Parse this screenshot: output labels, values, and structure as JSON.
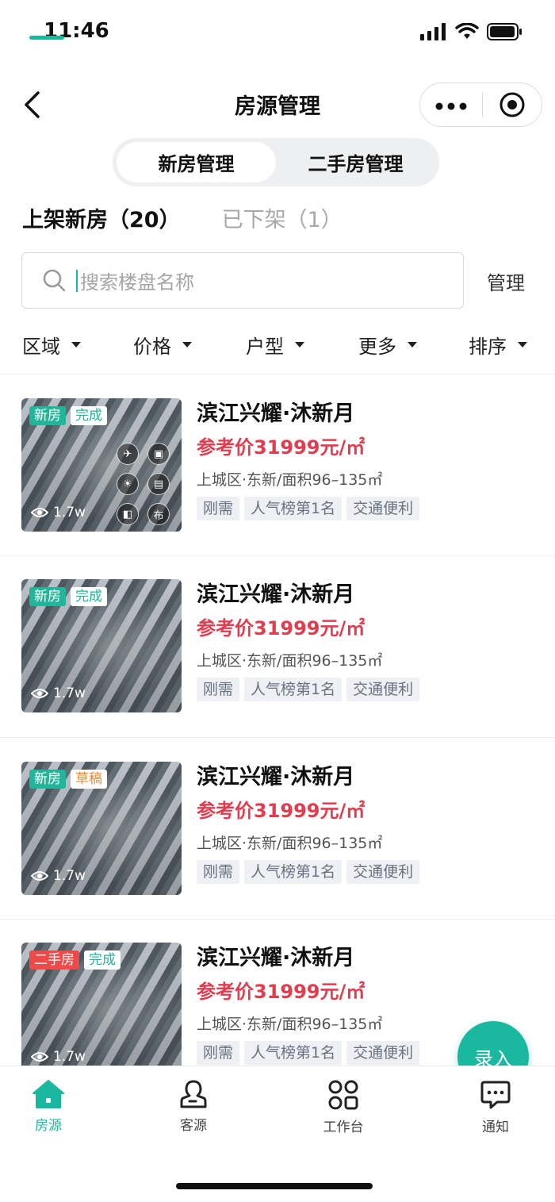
{
  "status_bar": {
    "time": "11:46"
  },
  "nav": {
    "title": "房源管理",
    "icons": [
      "back-arrow-icon",
      "more-dots-icon",
      "target-icon"
    ]
  },
  "segment": {
    "items": [
      "新房管理",
      "二手房管理"
    ],
    "active": 0
  },
  "tabs": [
    {
      "label": "上架新房（20）",
      "active": true
    },
    {
      "label": "已下架（1）",
      "active": false
    }
  ],
  "search": {
    "placeholder": "搜索楼盘名称",
    "manage_label": "管理"
  },
  "filters": [
    "区域",
    "价格",
    "户型",
    "更多",
    "排序"
  ],
  "listings": [
    {
      "type_tag": "新房",
      "status_tag": "完成",
      "views": "1.7w",
      "name": "滨江兴耀·沐新月",
      "price": "参考价31999元/㎡",
      "area": "上城区·东新/面积96–135㎡",
      "labels": [
        "刚需",
        "人气榜第1名",
        "交通便利"
      ],
      "has_media_icons": true
    },
    {
      "type_tag": "新房",
      "status_tag": "完成",
      "views": "1.7w",
      "name": "滨江兴耀·沐新月",
      "price": "参考价31999元/㎡",
      "area": "上城区·东新/面积96–135㎡",
      "labels": [
        "刚需",
        "人气榜第1名",
        "交通便利"
      ],
      "has_media_icons": false
    },
    {
      "type_tag": "新房",
      "status_tag": "草稿",
      "views": "1.7w",
      "name": "滨江兴耀·沐新月",
      "price": "参考价31999元/㎡",
      "area": "上城区·东新/面积96–135㎡",
      "labels": [
        "刚需",
        "人气榜第1名",
        "交通便利"
      ],
      "has_media_icons": false
    },
    {
      "type_tag": "二手房",
      "status_tag": "完成",
      "views": "1.7w",
      "name": "滨江兴耀·沐新月",
      "price": "参考价31999元/㎡",
      "area": "上城区·东新/面积96–135㎡",
      "labels": [
        "刚需",
        "人气榜第1名",
        "交通便利"
      ],
      "has_media_icons": false
    }
  ],
  "thumb_icons": [
    "helicopter-icon",
    "image-icon",
    "sun-icon",
    "floorplan-icon",
    "layout-icon",
    "布"
  ],
  "fab": {
    "label": "录入"
  },
  "tabbar": [
    {
      "label": "房源",
      "icon": "home-icon",
      "active": true
    },
    {
      "label": "客源",
      "icon": "person-icon",
      "active": false
    },
    {
      "label": "工作台",
      "icon": "grid-icon",
      "active": false
    },
    {
      "label": "通知",
      "icon": "chat-icon",
      "active": false
    }
  ],
  "colors": {
    "accent": "#1ab99f",
    "price": "#e23c4f",
    "draft": "#f08a2c",
    "second_hand": "#ee4a4a"
  }
}
